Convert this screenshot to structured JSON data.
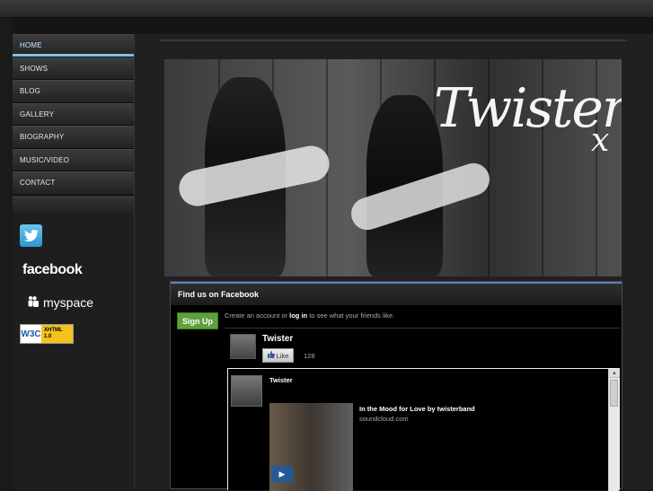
{
  "nav": {
    "items": [
      {
        "label": "HOME"
      },
      {
        "label": "SHOWS"
      },
      {
        "label": "BLOG"
      },
      {
        "label": "GALLERY"
      },
      {
        "label": "BIOGRAPHY"
      },
      {
        "label": "MUSIC/VIDEO"
      },
      {
        "label": "CONTACT"
      }
    ],
    "active": "HOME"
  },
  "social": {
    "twitter_icon": "twitter-bird-icon",
    "facebook_label": "facebook",
    "myspace_label": "myspace",
    "w3c_badge": {
      "left": "W3C",
      "right_line1": "XHTML",
      "right_line2": "1.0"
    }
  },
  "banner": {
    "title": "Twister",
    "mark": "x"
  },
  "facebook_box": {
    "header": "Find us on Facebook",
    "signup_label": "Sign Up",
    "create_text_pre": "Create an account or",
    "create_login": "log in",
    "create_text_post": "to see what your friends like.",
    "page_name": "Twister",
    "like_label": "Like",
    "like_count": "128",
    "post": {
      "author": "Twister",
      "link_title": "In the Mood for Love by twisterband",
      "link_source": "soundcloud.com"
    }
  },
  "colors": {
    "accent": "#7fc1e8",
    "facebook_blue": "#5d7fbf",
    "signup_green": "#5ea13e"
  }
}
